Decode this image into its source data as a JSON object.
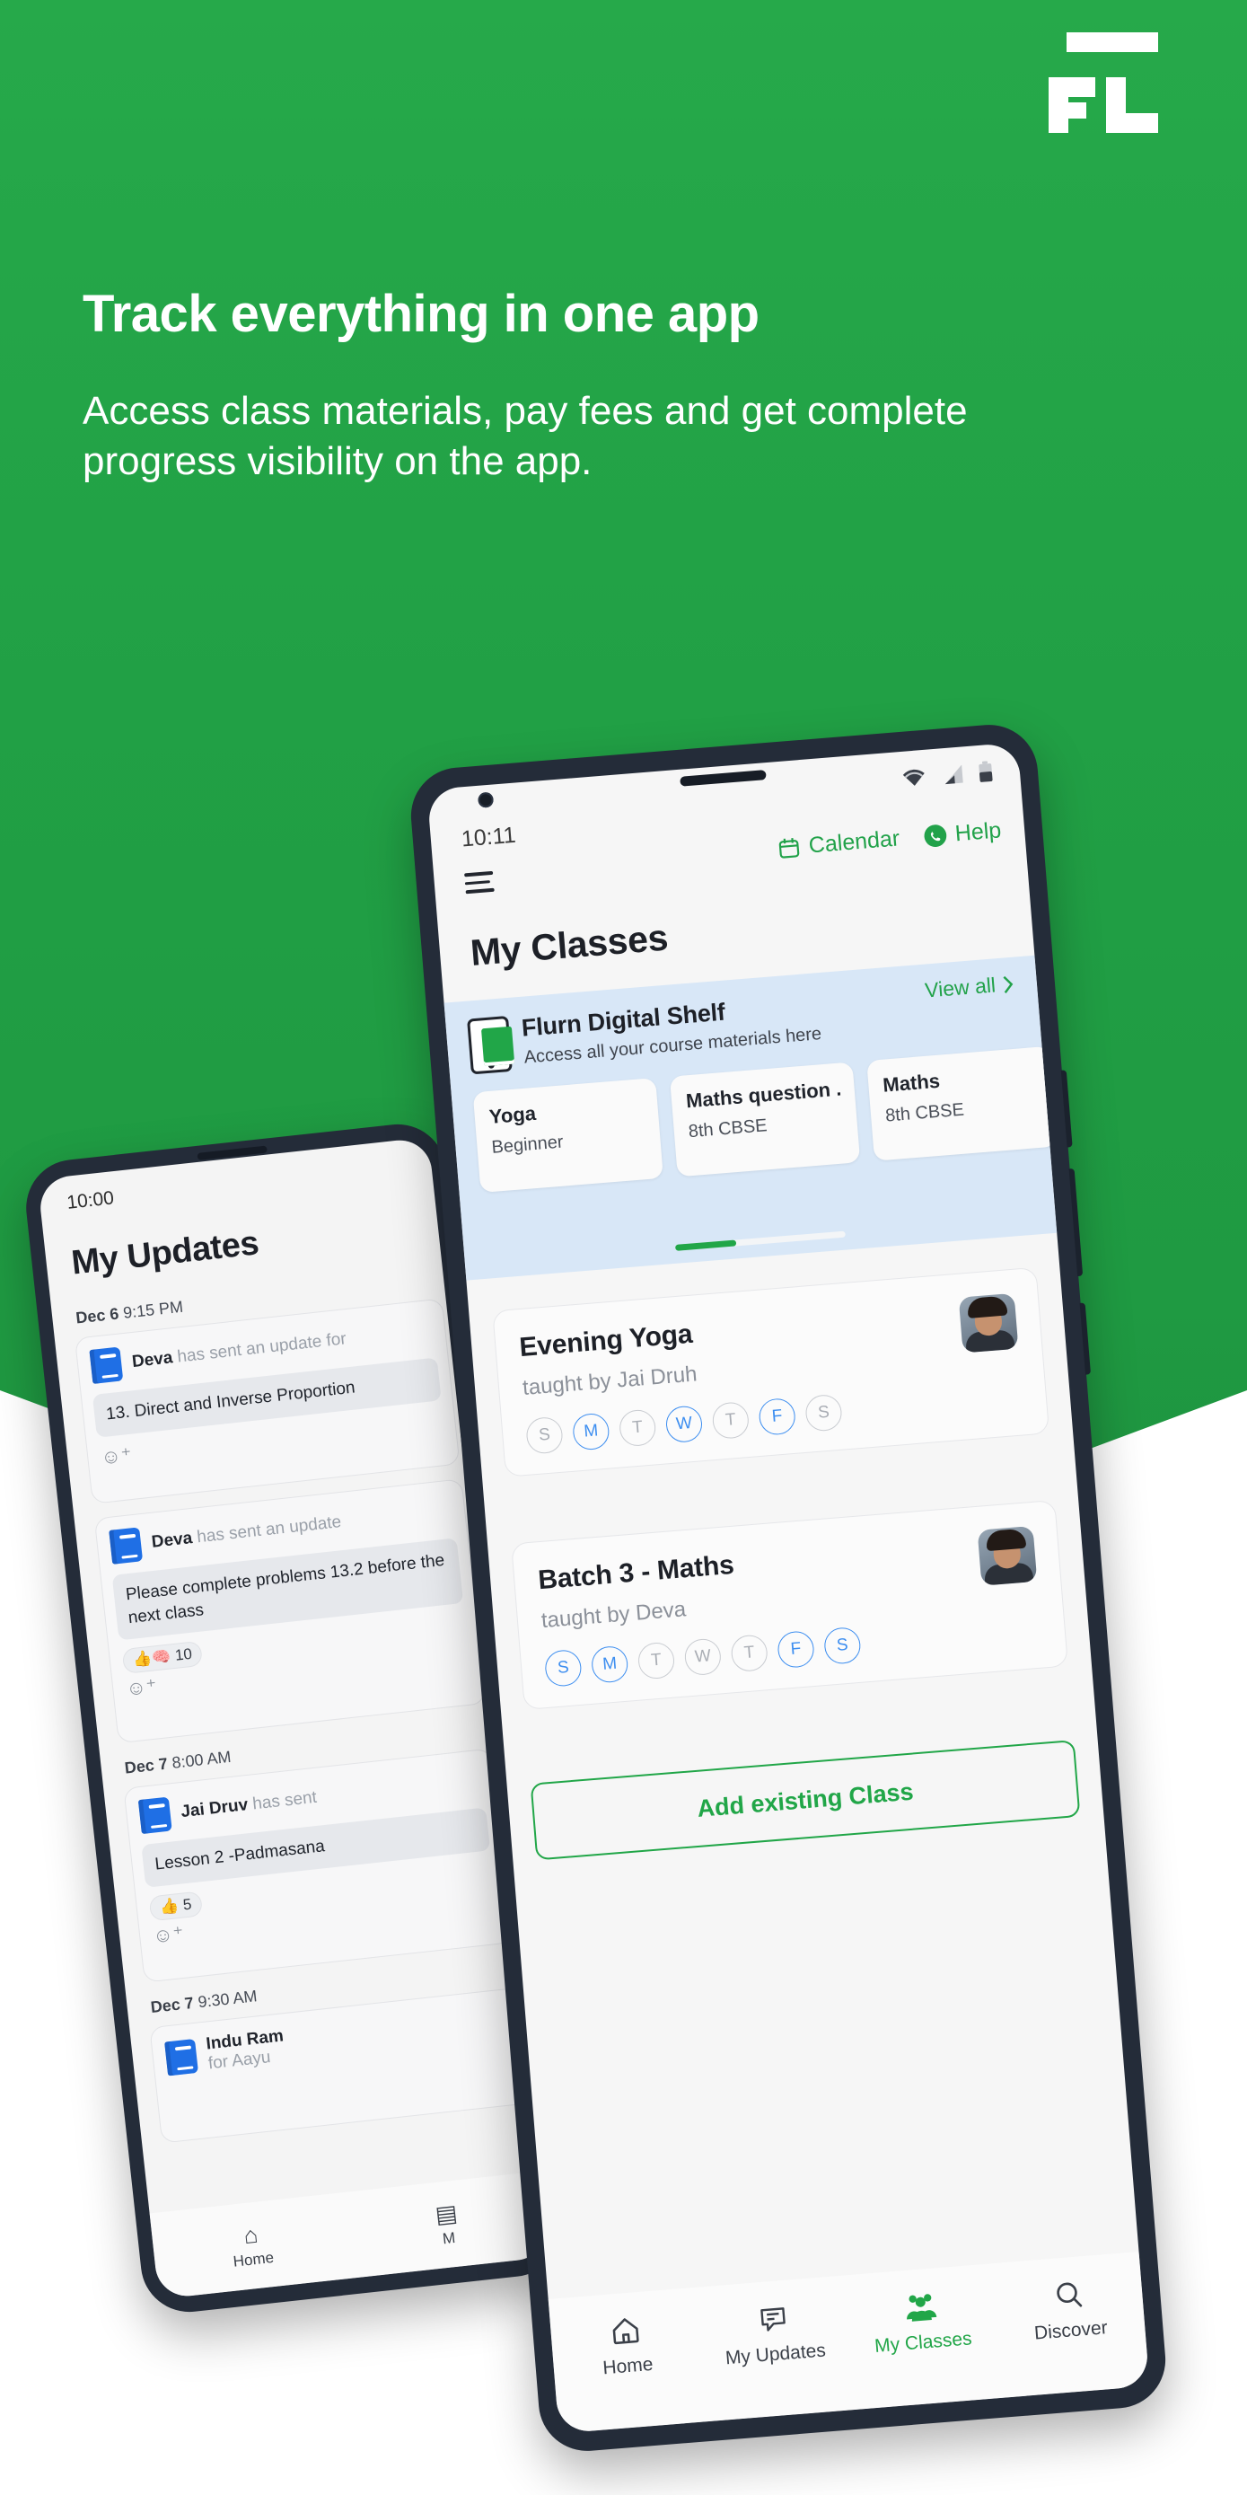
{
  "brand": {
    "logo_text": "FL",
    "accent_green": "#21a648",
    "bg_green": "#1f9a42"
  },
  "hero": {
    "headline": "Track everything in one app",
    "subhead": "Access class materials, pay fees and get complete progress visibility on the app."
  },
  "back_phone": {
    "status_time": "10:00",
    "page_title": "My Updates",
    "updates": [
      {
        "date": "Dec 6",
        "time": "9:15 PM",
        "sender": "Deva",
        "sender_suffix": "has sent an update for",
        "body": "13. Direct and Inverse Proportion",
        "reactions": []
      },
      {
        "date": "",
        "time": "",
        "sender": "Deva",
        "sender_suffix": "has sent an update",
        "body": "Please complete problems 13.2 before the next class",
        "reactions": [
          {
            "emoji": "👍🧠",
            "count": "10"
          }
        ]
      },
      {
        "date": "Dec 7",
        "time": "8:00 AM",
        "sender": "Jai Druv",
        "sender_suffix": "has sent",
        "body": "Lesson 2 -Padmasana",
        "reactions": [
          {
            "emoji": "👍",
            "count": "5"
          }
        ]
      },
      {
        "date": "Dec 7",
        "time": "9:30 AM",
        "sender": "Indu Ram",
        "sender_suffix": "for Aayu",
        "body": "",
        "reactions": []
      }
    ],
    "nav": [
      {
        "icon": "home-icon",
        "glyph": "⌂",
        "label": "Home"
      },
      {
        "icon": "updates-icon",
        "glyph": "▤",
        "label": "M"
      }
    ],
    "add_reaction_glyph": "☺⁺"
  },
  "front_phone": {
    "status_time": "10:11",
    "status_icons": [
      "wifi-icon",
      "signal-icon",
      "battery-icon"
    ],
    "menu_icon": "hamburger-icon",
    "top_actions": [
      {
        "icon": "calendar-icon",
        "label": "Calendar"
      },
      {
        "icon": "whatsapp-icon",
        "label": "Help"
      }
    ],
    "page_title": "My Classes",
    "shelf": {
      "icon": "phone-book-icon",
      "title": "Flurn Digital Shelf",
      "subtitle": "Access all your course materials here",
      "view_all_label": "View all",
      "view_all_icon": "chevron-right-icon",
      "cards": [
        {
          "name": "Yoga",
          "level": "Beginner"
        },
        {
          "name": "Maths question ...",
          "level": "8th CBSE"
        },
        {
          "name": "Maths",
          "level": "8th CBSE"
        }
      ],
      "scroll_progress": 36
    },
    "classes": [
      {
        "name": "Evening Yoga",
        "teacher": "taught by Jai Druh",
        "avatar": "teacher-avatar",
        "days": [
          {
            "label": "S",
            "active": false
          },
          {
            "label": "M",
            "active": true
          },
          {
            "label": "T",
            "active": false
          },
          {
            "label": "W",
            "active": true
          },
          {
            "label": "T",
            "active": false
          },
          {
            "label": "F",
            "active": true
          },
          {
            "label": "S",
            "active": false
          }
        ]
      },
      {
        "name": "Batch 3 - Maths",
        "teacher": "taught by Deva",
        "avatar": "teacher-avatar",
        "days": [
          {
            "label": "S",
            "active": true
          },
          {
            "label": "M",
            "active": true
          },
          {
            "label": "T",
            "active": false
          },
          {
            "label": "W",
            "active": false
          },
          {
            "label": "T",
            "active": false
          },
          {
            "label": "F",
            "active": true
          },
          {
            "label": "S",
            "active": true
          }
        ]
      }
    ],
    "add_class_label": "Add existing Class",
    "nav": [
      {
        "icon": "home-icon",
        "label": "Home",
        "active": false
      },
      {
        "icon": "updates-icon",
        "label": "My Updates",
        "active": false
      },
      {
        "icon": "classes-icon",
        "label": "My Classes",
        "active": true
      },
      {
        "icon": "search-icon",
        "label": "Discover",
        "active": false
      }
    ]
  }
}
